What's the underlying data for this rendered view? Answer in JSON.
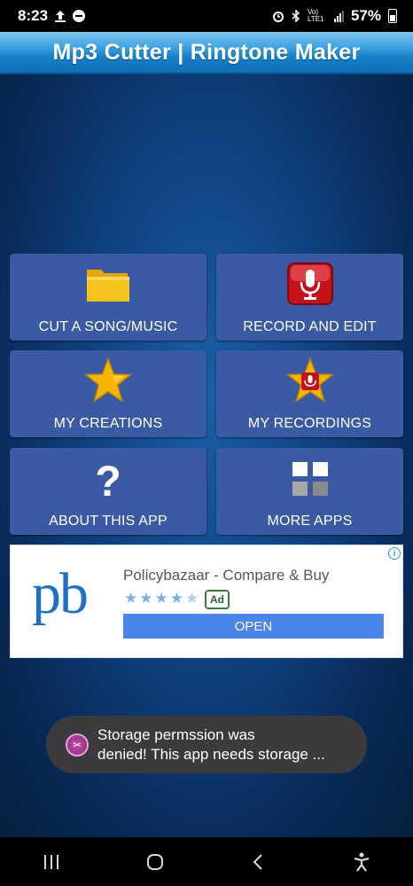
{
  "status_bar": {
    "time": "8:23",
    "battery": "57%",
    "volte": "Vo) LTE1"
  },
  "header": {
    "title": "Mp3 Cutter | Ringtone Maker",
    "accent": "#1780c8"
  },
  "tiles": [
    {
      "label": "CUT A SONG/MUSIC",
      "icon": "folder-icon"
    },
    {
      "label": "RECORD AND EDIT",
      "icon": "microphone-icon"
    },
    {
      "label": "MY CREATIONS",
      "icon": "star-icon"
    },
    {
      "label": "MY RECORDINGS",
      "icon": "star-microphone-icon"
    },
    {
      "label": "ABOUT THIS APP",
      "icon": "question-icon"
    },
    {
      "label": "MORE APPS",
      "icon": "grid-icon"
    }
  ],
  "ad": {
    "logo": "pb",
    "title": "Policybazaar - Compare & Buy",
    "rating": 4.5,
    "badge": "Ad",
    "cta": "OPEN",
    "cta_color": "#4a86e8"
  },
  "toast": {
    "line1": "Storage permssion was",
    "line2": "denied! This app needs storage ..."
  },
  "nav": {
    "recents": "|||",
    "home": "○",
    "back": "<",
    "accessibility": "accessibility-icon"
  }
}
